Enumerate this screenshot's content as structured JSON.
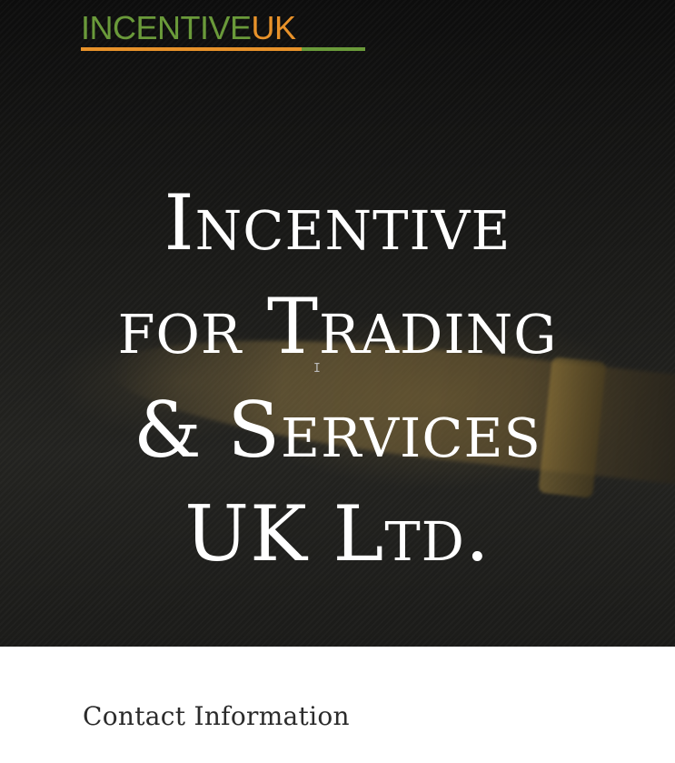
{
  "header": {
    "logo": {
      "main_text": "INCENTIVE",
      "accent_text": "UK",
      "main_color": "#6a9a3a",
      "accent_color": "#e8922a"
    }
  },
  "hero": {
    "title_lines": [
      "Incentive",
      "for Trading",
      "& Services",
      "UK Ltd."
    ],
    "background": "fountain-pen-photo",
    "cursor_icon": "text-cursor-icon"
  },
  "content": {
    "section_heading": "Contact Information"
  }
}
